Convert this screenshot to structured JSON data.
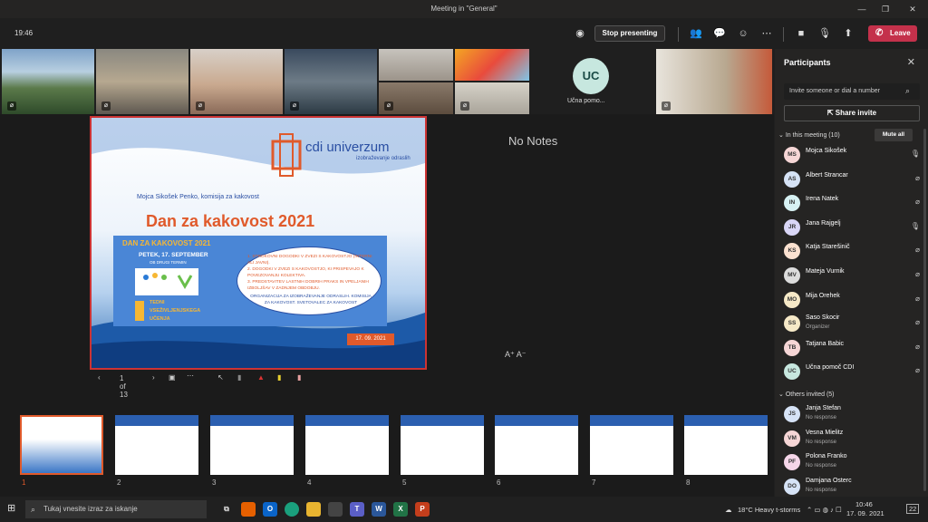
{
  "window": {
    "title": "Meeting in \"General\""
  },
  "toolbar": {
    "time": "19:46",
    "stop_label": "Stop presenting",
    "leave_label": "Leave"
  },
  "gallery": {
    "uc_initials": "UC",
    "uc_name": "Učna pomo..."
  },
  "stage": {
    "notes": "No Notes",
    "font_controls": "A⁺  A⁻",
    "page": "1 of 13"
  },
  "slide": {
    "brand": "cdi univerzum",
    "brand_sub": "izobraževanje odraslih",
    "author": "Mojca Sikošek Penko, komisija za kakovost",
    "title": "Dan za kakovost 2021",
    "box_title": "DAN ZA KAKOVOST 2021",
    "box_date": "PETEK, 17. SEPTEMBER",
    "box_sub": "OB DRUGI TERMIN",
    "box_teden": "TEDNI VSEŽIVLJENJSKEGA UČENJA",
    "items": [
      "1. STROKOVNI DOGODKI V ZVEZI S KAKOVOSTJO (INTERNI ALI JAVNI).",
      "2. DOGODKI V ZVEZI S KAKOVOSTJO, KI PRISPEVAJO K POVEZOVANJU KOLEKTIVA.",
      "3. PREDSTAVITEV LASTNIH DOBRIH PRAKS IN VPELJANIH IZBOLJŠAV V ZADNJEM OBDOBJU."
    ],
    "footer_note": "ORGANIZACIJA ZA IZOBRAŽEVANJE ODRASLIH. KOMISIJA ZA KAKOVOST. SVETOVALEC ZA KAKOVOST",
    "date": "17. 09. 2021"
  },
  "thumbnails": [
    "1",
    "2",
    "3",
    "4",
    "5",
    "6",
    "7",
    "8"
  ],
  "panel": {
    "title": "Participants",
    "invite_placeholder": "Invite someone or dial a number",
    "share_label": "Share invite",
    "in_meeting": "In this meeting (10)",
    "mute_all": "Mute all",
    "others": "Others invited (5)",
    "people": [
      {
        "ini": "MS",
        "name": "Mojca Sikošek",
        "role": "",
        "color": "#f6d6d6"
      },
      {
        "ini": "AS",
        "name": "Albert Strancar",
        "role": "",
        "color": "#d6e3f6"
      },
      {
        "ini": "IN",
        "name": "Irena Natek",
        "role": "",
        "color": "#d6f1f3"
      },
      {
        "ini": "JR",
        "name": "Jana Rajgelj",
        "role": "",
        "color": "#d9d6f6"
      },
      {
        "ini": "KS",
        "name": "Katja Starešinič",
        "role": "",
        "color": "#fbe1d0"
      },
      {
        "ini": "MV",
        "name": "Mateja Vurnik",
        "role": "",
        "color": "#dcdcdc"
      },
      {
        "ini": "MO",
        "name": "Mija Orehek",
        "role": "",
        "color": "#f6e9c7"
      },
      {
        "ini": "SS",
        "name": "Saso Skocir",
        "role": "Organizer",
        "color": "#f6e9c7"
      },
      {
        "ini": "TB",
        "name": "Tatjana Babic",
        "role": "",
        "color": "#f6d6d6"
      },
      {
        "ini": "UC",
        "name": "Učna pomoč CDI",
        "role": "",
        "color": "#c7e7df"
      }
    ],
    "invited": [
      {
        "ini": "JS",
        "name": "Janja Stefan",
        "role": "No response",
        "color": "#d6e3f6"
      },
      {
        "ini": "VM",
        "name": "Vesna Mielitz",
        "role": "No response",
        "color": "#f6d6d6"
      },
      {
        "ini": "PF",
        "name": "Polona Franko",
        "role": "No response",
        "color": "#f6d6e9"
      },
      {
        "ini": "DO",
        "name": "Damjana Osterc",
        "role": "No response",
        "color": "#d6e3f6"
      }
    ]
  },
  "taskbar": {
    "search": "Tukaj vnesite izraz za iskanje",
    "weather": "18°C  Heavy t-storms",
    "time": "10:46",
    "date": "17. 09. 2021",
    "notif": "22"
  }
}
